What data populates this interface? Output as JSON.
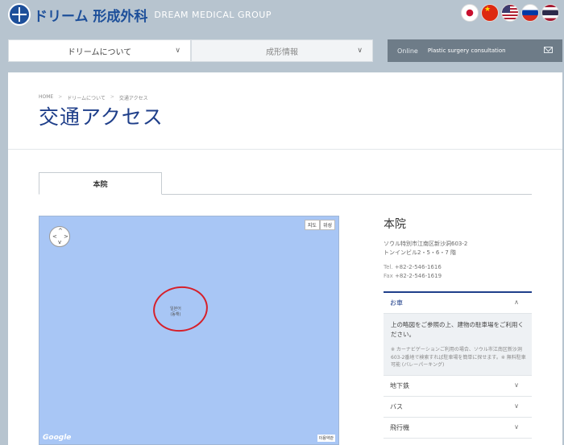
{
  "header": {
    "logo_jp": "ドリーム 形成外科",
    "logo_en": "DREAM MEDICAL GROUP",
    "flags": [
      "korea-flag-icon",
      "china-flag-icon",
      "usa-flag-icon",
      "russia-flag-icon",
      "thailand-flag-icon"
    ]
  },
  "nav": {
    "about_label": "ドリームについて",
    "info_label": "成形情報",
    "online_label": "Online",
    "online_sub": "Plastic surgery consultation"
  },
  "breadcrumb": [
    "HOME",
    "ドリームについて",
    "交通アクセス"
  ],
  "page_title": "交通アクセス",
  "tab_label": "本院",
  "map": {
    "type_buttons": [
      "지도",
      "위성"
    ],
    "marker_label_line1": "일본어",
    "marker_label_line2": "(동해)",
    "google_label": "Google",
    "terms_label": "이용약관"
  },
  "info": {
    "title": "本院",
    "address_line1": "ソウル特別市江南区新沙洞603-2",
    "address_line2": "トンインビル2・5・6・7 階",
    "tel_label": "Tel.",
    "tel": "+82-2-546-1616",
    "fax_label": "Fax",
    "fax": "+82-2-546-1619"
  },
  "accordion": {
    "car_label": "お車",
    "car_text": "上の略図をご参照の上、建物の駐車場をご利用ください。",
    "car_note": "※ カーナビゲーションご利用の場合、ソウル市江南区新沙洞603-2番地で検索すれば駐車場を簡単に探せます。※ 無料駐車可能 (バレーパーキング)",
    "subway_label": "地下鉄",
    "bus_label": "バス",
    "airplane_label": "飛行機"
  },
  "colors": {
    "accent": "#1f3f8a",
    "background": "#b7c4cf",
    "map_water": "#a8c6f5",
    "marker_circle": "#d6202a"
  }
}
